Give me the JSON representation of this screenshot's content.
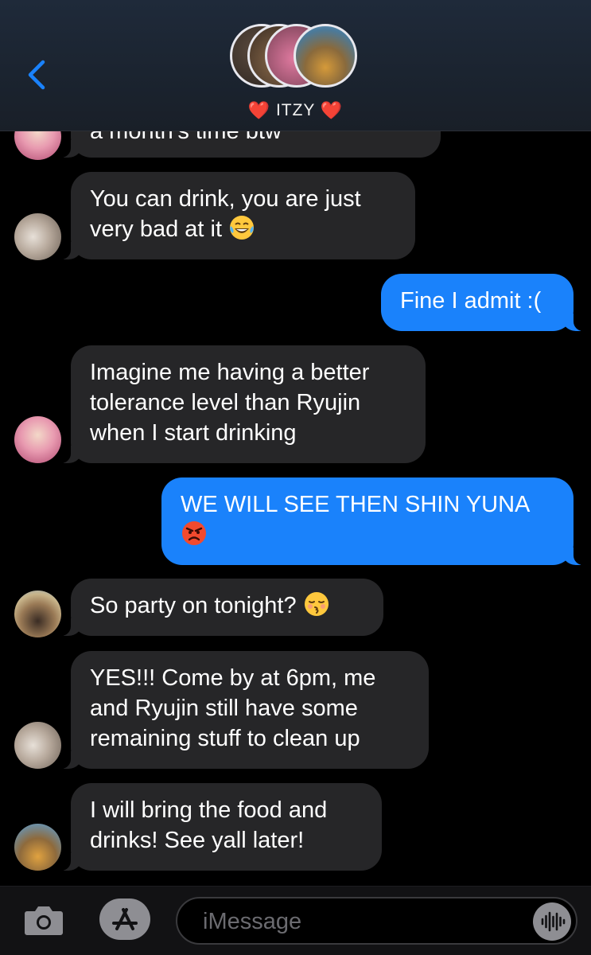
{
  "header": {
    "group_name": "ITZY",
    "heart_left": "❤️",
    "heart_right": "❤️",
    "back_icon": "chevron-left-icon"
  },
  "messages": [
    {
      "direction": "in",
      "lines": [
        "a month's time btw"
      ],
      "emoji": ""
    },
    {
      "direction": "in",
      "lines": [
        "You can drink, you are just",
        "very bad at it"
      ],
      "emoji": "tears-of-joy"
    },
    {
      "direction": "out",
      "lines": [
        "Fine I admit :("
      ],
      "emoji": ""
    },
    {
      "direction": "in",
      "lines": [
        "Imagine me having a better",
        "tolerance level than Ryujin",
        "when I start drinking"
      ],
      "emoji": ""
    },
    {
      "direction": "out",
      "lines": [
        "WE WILL SEE THEN SHIN YUNA"
      ],
      "emoji": "angry-face"
    },
    {
      "direction": "in",
      "lines": [
        "So party on tonight?"
      ],
      "emoji": "kissing-face"
    },
    {
      "direction": "in",
      "lines": [
        "YES!!! Come by at 6pm, me",
        "and Ryujin still have some",
        "remaining stuff to clean up"
      ],
      "emoji": ""
    },
    {
      "direction": "in",
      "lines": [
        "I will bring the food and",
        "drinks! See yall later!"
      ],
      "emoji": ""
    }
  ],
  "input": {
    "placeholder": "iMessage"
  },
  "colors": {
    "outgoing_bubble": "#1a82fb",
    "incoming_bubble": "#262628",
    "background": "#000000",
    "accent": "#1a82fb"
  }
}
